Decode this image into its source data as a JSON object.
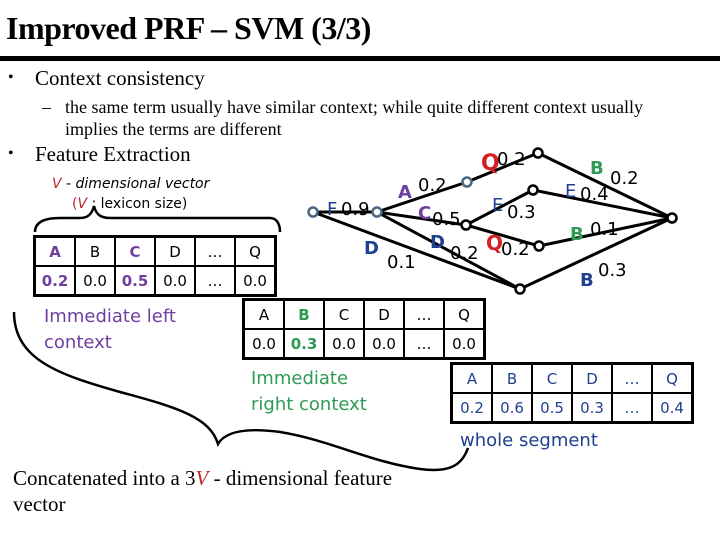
{
  "slide": {
    "title": "Improved PRF – SVM (3/3)",
    "bullets": [
      {
        "text": "Context consistency",
        "sub": [
          "the same term usually have similar context; while quite different context usually",
          "implies the terms are different"
        ]
      },
      {
        "text": "Feature Extraction",
        "sub": []
      }
    ],
    "bullet_glyph": "•",
    "dash_glyph": "–"
  },
  "vector_caption": {
    "line1_var": "V",
    "line1_rest": " - dimensional vector",
    "line2_open": "(",
    "line2_var": "V",
    "line2_rest": " ;  lexicon size)"
  },
  "colors": {
    "purple": "#6f3fa0",
    "green": "#2e9a55",
    "blue": "#1f3f8f",
    "red": "#c0262d",
    "node_fill": "#4b6584"
  },
  "left_context": {
    "label": [
      "Immediate left",
      "context"
    ],
    "headers": [
      "A",
      "B",
      "C",
      "D",
      "…",
      "Q"
    ],
    "values": [
      "0.2",
      "0.0",
      "0.5",
      "0.0",
      "…",
      "0.0"
    ],
    "highlight": [
      0,
      2
    ]
  },
  "right_context": {
    "label": [
      "Immediate",
      "right context"
    ],
    "headers": [
      "A",
      "B",
      "C",
      "D",
      "…",
      "Q"
    ],
    "values": [
      "0.0",
      "0.3",
      "0.0",
      "0.0",
      "…",
      "0.0"
    ],
    "highlight": [
      1
    ]
  },
  "whole_segment": {
    "label": "whole segment",
    "headers": [
      "A",
      "B",
      "C",
      "D",
      "…",
      "Q"
    ],
    "values": [
      "0.2",
      "0.6",
      "0.5",
      "0.3",
      "…",
      "0.4"
    ]
  },
  "lattice": {
    "edges": [
      {
        "symbol": "F",
        "weight": "0.9",
        "color": "#1f3f8f"
      },
      {
        "symbol": "A",
        "weight": "0.2",
        "color": "#6f3fa0"
      },
      {
        "symbol": "C",
        "weight": "0.5",
        "color": "#6f3fa0"
      },
      {
        "symbol": "D",
        "weight": "0.2",
        "color": "#1f3f8f"
      },
      {
        "symbol": "D",
        "weight": "0.1",
        "color": "#1f3f8f"
      },
      {
        "symbol": "Q",
        "weight": "0.2",
        "color": "#d42020"
      },
      {
        "symbol": "E",
        "weight": "0.3",
        "color": "#1f3f8f"
      },
      {
        "symbol": "Q",
        "weight": "0.2",
        "color": "#d42020"
      },
      {
        "symbol": "B",
        "weight": "0.2",
        "color": "#2e9a55"
      },
      {
        "symbol": "E",
        "weight": "0.4",
        "color": "#1f3f8f"
      },
      {
        "symbol": "B",
        "weight": "0.1",
        "color": "#2e9a55"
      },
      {
        "symbol": "B",
        "weight": "0.3",
        "color": "#1f3f8f"
      }
    ]
  },
  "conclusion": {
    "pre": "Concatenated into a 3",
    "var": "V",
    "post": " - dimensional feature vector"
  }
}
